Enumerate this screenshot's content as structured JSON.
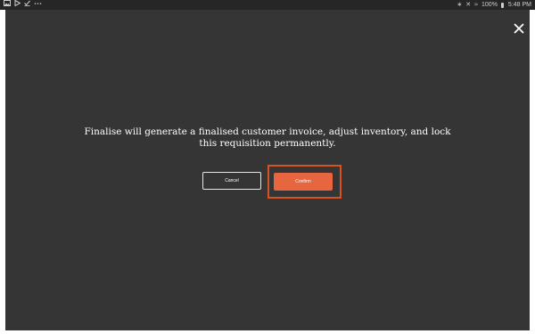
{
  "status_bar": {
    "left_icons": [
      "image-icon",
      "play-store-icon",
      "checkmark-icon",
      "more-icon"
    ],
    "bluetooth": "∗",
    "mute": "✕",
    "wifi": "≈",
    "battery": "100%",
    "time": "5:48 PM"
  },
  "dialog": {
    "message_line_1": "Finalise will generate a finalised customer invoice, adjust inventory, and lock",
    "message_line_2": "this requisition permanently.",
    "cancel_label": "Cancel",
    "confirm_label": "Confirm"
  },
  "colors": {
    "backdrop": "#353535",
    "status_bar": "#262626",
    "confirm": "#e8663f",
    "highlight": "#d9511c"
  }
}
